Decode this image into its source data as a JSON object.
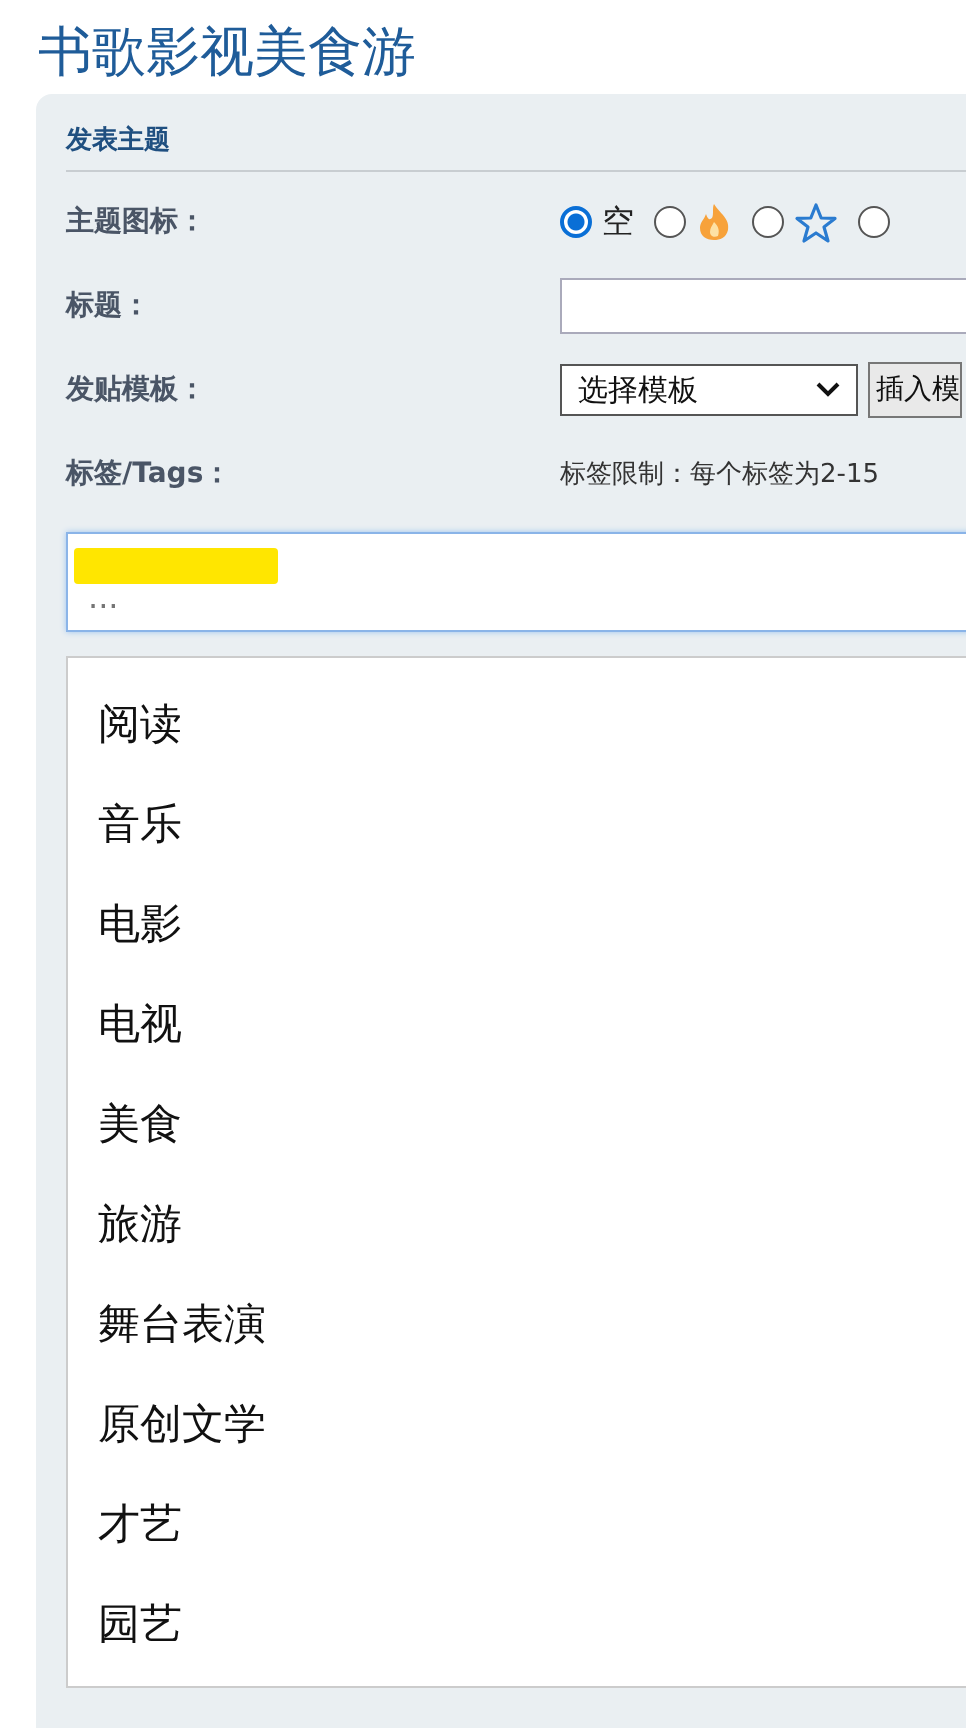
{
  "page_title": "书歌影视美食游",
  "form": {
    "heading": "发表主题",
    "icon_row": {
      "label": "主题图标：",
      "options": [
        {
          "kind": "text",
          "label": "空",
          "selected": true
        },
        {
          "kind": "fire",
          "selected": false
        },
        {
          "kind": "star",
          "selected": false
        },
        {
          "kind": "blank",
          "selected": false
        }
      ]
    },
    "title_row": {
      "label": "标题："
    },
    "template_row": {
      "label": "发贴模板：",
      "select_value": "选择模板",
      "button": "插入模"
    },
    "tags_row": {
      "label": "标签/Tags：",
      "hint": "标签限制：每个标签为2-15"
    },
    "tags_input": {
      "placeholder": "..."
    },
    "suggestions": [
      {
        "label": "阅读"
      },
      {
        "label": "音乐"
      },
      {
        "label": "电影"
      },
      {
        "label": "电视"
      },
      {
        "label": "美食"
      },
      {
        "label": "旅游"
      },
      {
        "label": "舞台表演"
      },
      {
        "label": "原创文学"
      },
      {
        "label": "才艺"
      },
      {
        "label": "园艺"
      }
    ]
  }
}
